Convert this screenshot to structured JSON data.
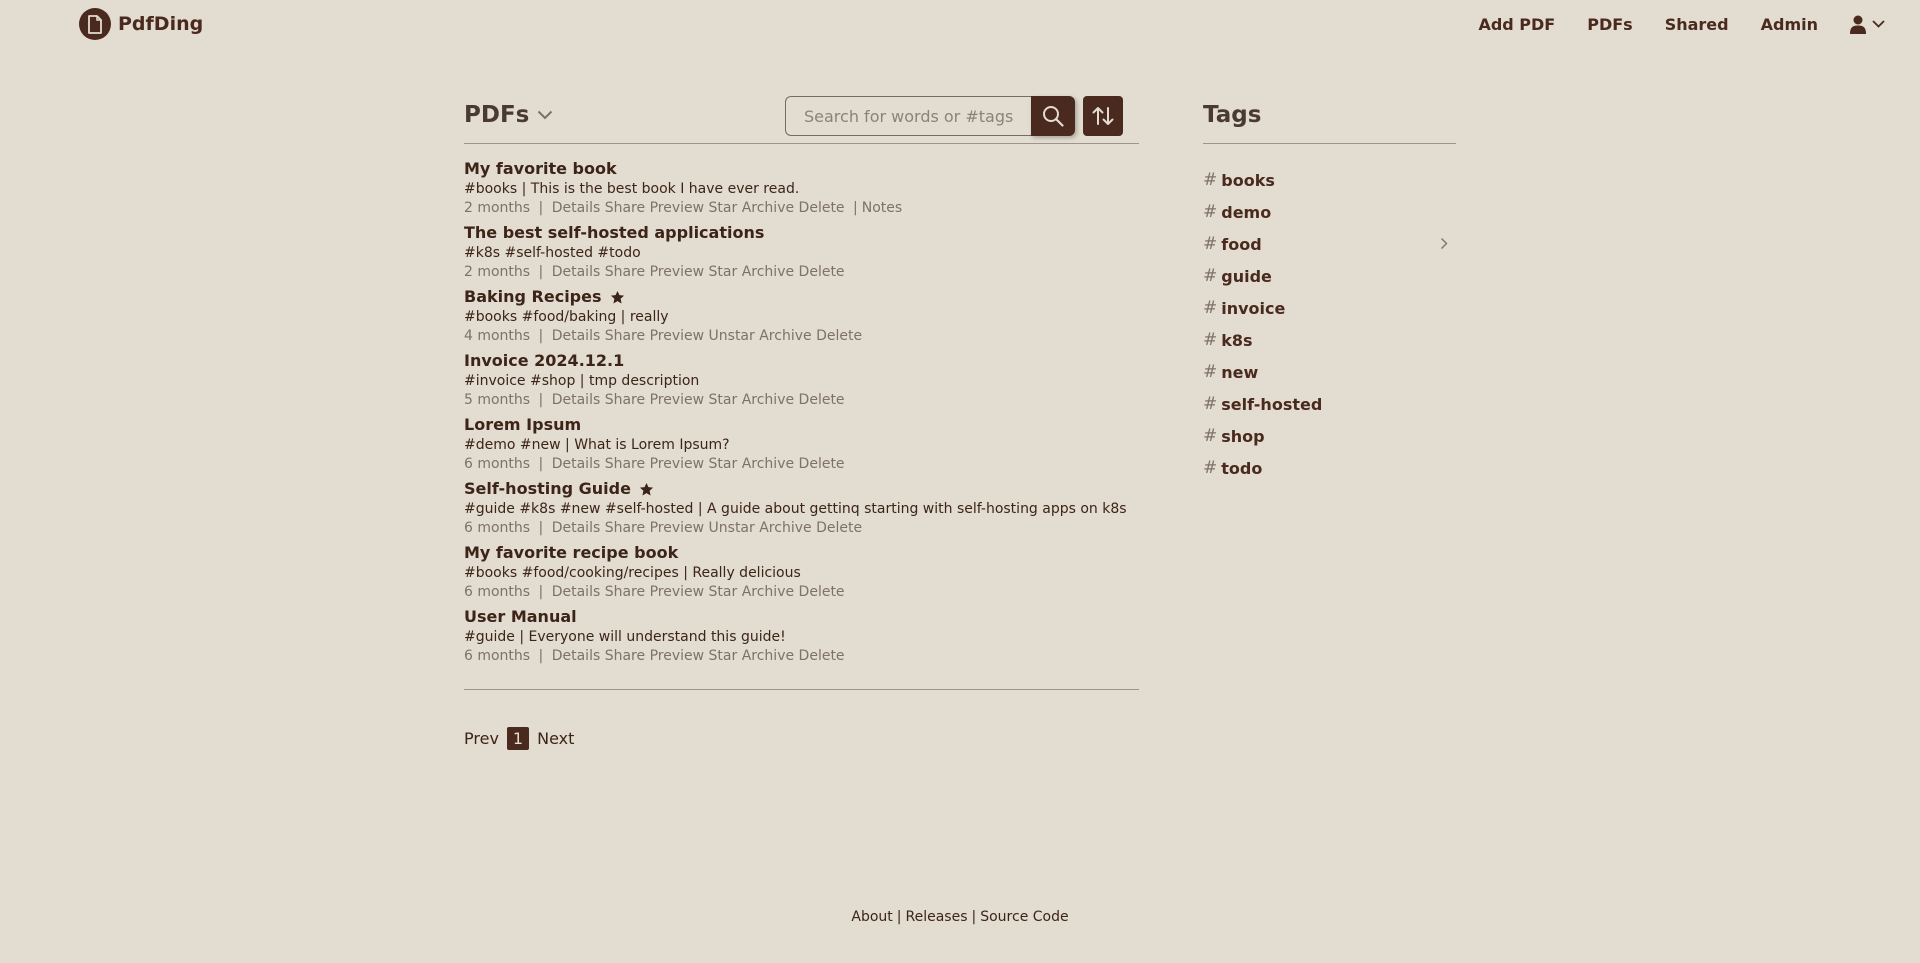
{
  "brand": {
    "name": "PdfDing"
  },
  "nav": {
    "items": [
      {
        "label": "Add PDF"
      },
      {
        "label": "PDFs"
      },
      {
        "label": "Shared"
      },
      {
        "label": "Admin"
      }
    ]
  },
  "main": {
    "title": "PDFs",
    "search_placeholder": "Search for words or #tags",
    "pdfs": [
      {
        "title": "My favorite book",
        "starred": false,
        "tags": "#books",
        "description": "This is the best book I have ever read.",
        "age": "2 months",
        "actions": [
          "Details",
          "Share",
          "Preview",
          "Star",
          "Archive",
          "Delete"
        ],
        "notes": "Notes"
      },
      {
        "title": "The best self-hosted applications",
        "starred": false,
        "tags": "#k8s #self-hosted #todo",
        "description": "",
        "age": "2 months",
        "actions": [
          "Details",
          "Share",
          "Preview",
          "Star",
          "Archive",
          "Delete"
        ]
      },
      {
        "title": "Baking Recipes",
        "starred": true,
        "tags": "#books #food/baking",
        "description": "really",
        "age": "4 months",
        "actions": [
          "Details",
          "Share",
          "Preview",
          "Unstar",
          "Archive",
          "Delete"
        ]
      },
      {
        "title": "Invoice 2024.12.1",
        "starred": false,
        "tags": "#invoice #shop",
        "description": "tmp description",
        "age": "5 months",
        "actions": [
          "Details",
          "Share",
          "Preview",
          "Star",
          "Archive",
          "Delete"
        ]
      },
      {
        "title": "Lorem Ipsum",
        "starred": false,
        "tags": "#demo #new",
        "description": "What is Lorem Ipsum?",
        "age": "6 months",
        "actions": [
          "Details",
          "Share",
          "Preview",
          "Star",
          "Archive",
          "Delete"
        ]
      },
      {
        "title": "Self-hosting Guide",
        "starred": true,
        "tags": "#guide #k8s #new #self-hosted",
        "description": "A guide about gettinq starting with self-hosting apps on k8s",
        "age": "6 months",
        "actions": [
          "Details",
          "Share",
          "Preview",
          "Unstar",
          "Archive",
          "Delete"
        ]
      },
      {
        "title": "My favorite recipe book",
        "starred": false,
        "tags": "#books #food/cooking/recipes",
        "description": "Really delicious",
        "age": "6 months",
        "actions": [
          "Details",
          "Share",
          "Preview",
          "Star",
          "Archive",
          "Delete"
        ]
      },
      {
        "title": "User Manual",
        "starred": false,
        "tags": "#guide",
        "description": "Everyone will understand this guide!",
        "age": "6 months",
        "actions": [
          "Details",
          "Share",
          "Preview",
          "Star",
          "Archive",
          "Delete"
        ]
      }
    ],
    "pagination": {
      "prev": "Prev",
      "current": "1",
      "next": "Next"
    }
  },
  "tags": {
    "title": "Tags",
    "items": [
      {
        "name": "books",
        "has_children": false
      },
      {
        "name": "demo",
        "has_children": false
      },
      {
        "name": "food",
        "has_children": true
      },
      {
        "name": "guide",
        "has_children": false
      },
      {
        "name": "invoice",
        "has_children": false
      },
      {
        "name": "k8s",
        "has_children": false
      },
      {
        "name": "new",
        "has_children": false
      },
      {
        "name": "self-hosted",
        "has_children": false
      },
      {
        "name": "shop",
        "has_children": false
      },
      {
        "name": "todo",
        "has_children": false
      }
    ]
  },
  "footer": {
    "links": [
      "About",
      "Releases",
      "Source Code"
    ]
  },
  "colors": {
    "background": "#e3dcd0",
    "accent": "#4a2a1e",
    "muted": "#7d716a"
  },
  "icons": {
    "logo": "document-icon",
    "user": "user-icon",
    "search": "search-icon",
    "sort": "sort-icon",
    "star": "star-icon"
  }
}
